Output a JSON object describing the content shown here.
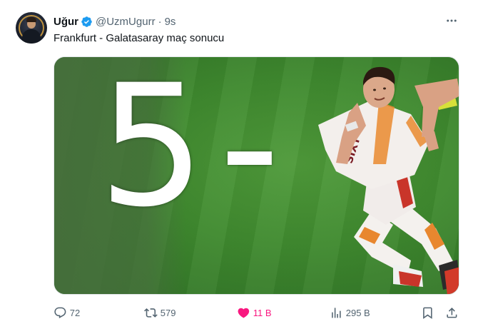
{
  "author": {
    "display_name": "Uğur",
    "handle": "@UzmUgurr",
    "separator": "·",
    "time": "9s",
    "verified": true,
    "avatar_icon": "profile-avatar"
  },
  "tweet": {
    "text": "Frankfurt - Galatasaray maç sonucu"
  },
  "media": {
    "overlay_text": "5-"
  },
  "actions": {
    "reply": {
      "count": "72",
      "icon": "reply-icon"
    },
    "retweet": {
      "count": "579",
      "icon": "retweet-icon"
    },
    "like": {
      "count": "11 B",
      "icon": "heart-icon",
      "liked": true
    },
    "views": {
      "count": "295 B",
      "icon": "views-icon"
    },
    "bookmark": {
      "icon": "bookmark-icon"
    },
    "share": {
      "icon": "share-icon"
    }
  },
  "colors": {
    "text_primary": "#0f1419",
    "text_secondary": "#536471",
    "verified_blue": "#1d9bf0",
    "like_pink": "#f91880"
  }
}
